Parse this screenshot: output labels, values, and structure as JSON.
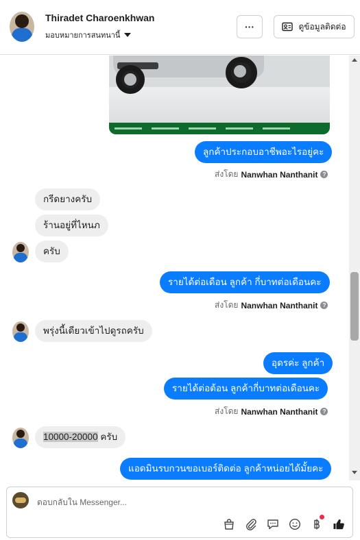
{
  "header": {
    "contact_name": "Thiradet Charoenkhwan",
    "assign_label": "มอบหมายการสนทนานี้",
    "more_label": "···",
    "view_profile_label": "ดูข้อมูลติดต่อ"
  },
  "messages": [
    {
      "text": "ลูกค้าประกอบอาชีพอะไรอยู่คะ"
    },
    {
      "text": "กรีดยางครับ"
    },
    {
      "text": "ร้านอยู่ที่ไหนภ"
    },
    {
      "text": "ครับ"
    },
    {
      "text": "รายได้ต่อเดือน ลูกค้า กี่บาทต่อเดือนคะ"
    },
    {
      "text": "พรุ่งนี้เดียวเข้าไปดูรถครับ"
    },
    {
      "text": "อุดรค่ะ ลูกค้า"
    },
    {
      "text": "รายได้ต่อต้อน  ลูกค้ากี่บาทต่อเดือนคะ"
    },
    {
      "text_highlight": "10000-20000",
      "text_rest": " ครับ"
    },
    {
      "text": "แอดมินรบกวนขอเบอร์ติดต่อ ลูกค้าหน่อยได้มั้ยคะ"
    }
  ],
  "sent_by": {
    "prefix": "ส่งโดย",
    "name": "Nanwhan Nanthanit",
    "help_glyph": "?"
  },
  "composer": {
    "placeholder": "ตอบกลับใน Messenger..."
  },
  "icons": {
    "more": "more-dots-icon",
    "profile": "contact-card-icon",
    "shop": "shopping-bag-icon",
    "attach": "paperclip-icon",
    "saved_reply": "chat-bubble-icon",
    "emoji": "smiley-icon",
    "payment": "baht-icon",
    "like": "thumbs-up-icon"
  },
  "colors": {
    "outgoing_bubble": "#0a7cff",
    "incoming_bubble": "#eeeeee",
    "notification_dot": "#f02849"
  }
}
